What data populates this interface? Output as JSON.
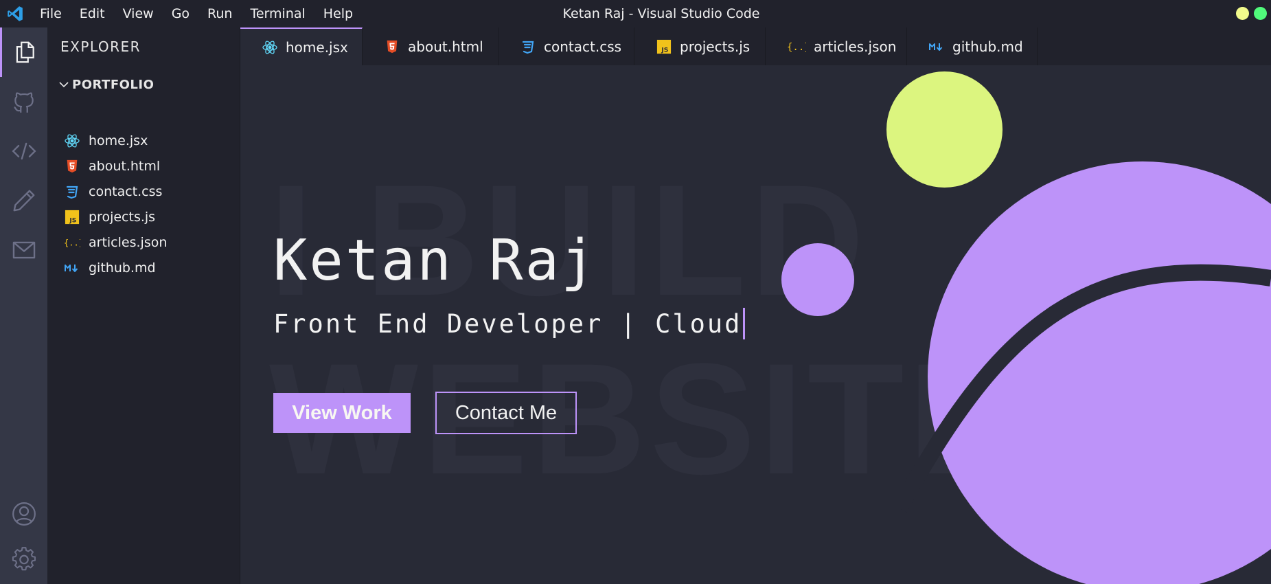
{
  "window": {
    "title": "Ketan Raj - Visual Studio Code",
    "menu": [
      "File",
      "Edit",
      "View",
      "Go",
      "Run",
      "Terminal",
      "Help"
    ]
  },
  "activity_bar": {
    "icons": [
      "files-icon",
      "github-icon",
      "code-icon",
      "pencil-icon",
      "mail-icon",
      "account-icon",
      "gear-icon"
    ],
    "active": "files-icon"
  },
  "sidebar": {
    "title": "EXPLORER",
    "folder": "PORTFOLIO",
    "files": [
      {
        "label": "home.jsx",
        "icon": "react-icon"
      },
      {
        "label": "about.html",
        "icon": "html5-icon"
      },
      {
        "label": "contact.css",
        "icon": "css3-icon"
      },
      {
        "label": "projects.js",
        "icon": "javascript-icon"
      },
      {
        "label": "articles.json",
        "icon": "json-icon"
      },
      {
        "label": "github.md",
        "icon": "markdown-icon"
      }
    ]
  },
  "tabs": [
    {
      "label": "home.jsx",
      "icon": "react-icon",
      "active": true
    },
    {
      "label": "about.html",
      "icon": "html5-icon"
    },
    {
      "label": "contact.css",
      "icon": "css3-icon"
    },
    {
      "label": "projects.js",
      "icon": "javascript-icon"
    },
    {
      "label": "articles.json",
      "icon": "json-icon"
    },
    {
      "label": "github.md",
      "icon": "markdown-icon"
    }
  ],
  "hero": {
    "background_words": [
      "I BUILD",
      "WEBSITES"
    ],
    "name": "Ketan Raj",
    "subtitle": "Front End Developer | Cloud",
    "primary_button": "View Work",
    "secondary_button": "Contact Me"
  },
  "colors": {
    "accent": "#bd93f9",
    "yellow": "#dcf57f",
    "background": "#282a36",
    "sidebar": "#21222c",
    "activity_bar": "#343746"
  }
}
